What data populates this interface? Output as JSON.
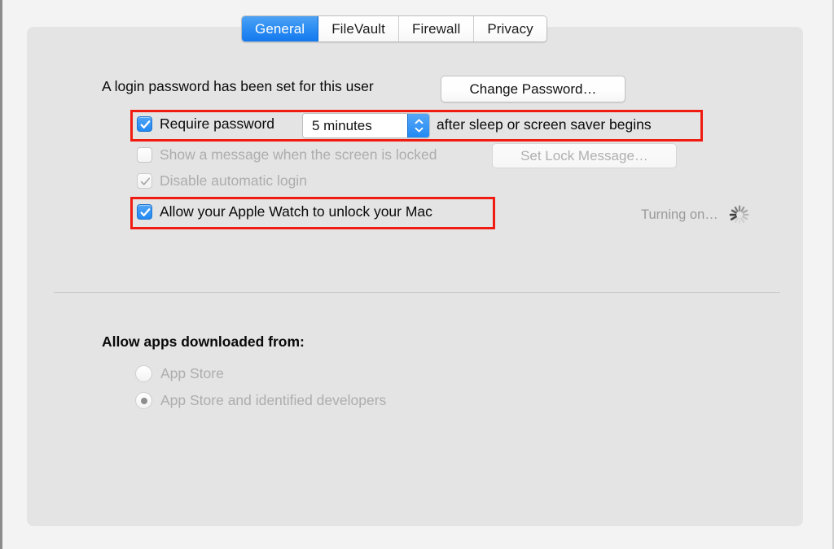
{
  "window": {
    "panel_name": "security-privacy-preference-panel"
  },
  "tabs": [
    {
      "label": "General",
      "selected": true
    },
    {
      "label": "FileVault",
      "selected": false
    },
    {
      "label": "Firewall",
      "selected": false
    },
    {
      "label": "Privacy",
      "selected": false
    }
  ],
  "general": {
    "password_status": "A login password has been set for this user",
    "change_password_label": "Change Password…",
    "require_password": {
      "label": "Require password",
      "checked": true,
      "delay_value": "5 minutes",
      "trailing_text": "after sleep or screen saver begins",
      "stepper_up_icon": "chevron-up-icon",
      "stepper_down_icon": "chevron-down-icon"
    },
    "show_lock_message": {
      "label": "Show a message when the screen is locked",
      "checked": false,
      "button_label": "Set Lock Message…",
      "disabled": true
    },
    "disable_automatic_login": {
      "label": "Disable automatic login",
      "checked": true,
      "disabled": true
    },
    "apple_watch_unlock": {
      "label": "Allow your Apple Watch to unlock your Mac",
      "checked": true,
      "status_label": "Turning on…",
      "status_icon": "spinner-icon"
    }
  },
  "gatekeeper": {
    "heading": "Allow apps downloaded from:",
    "options": [
      {
        "label": "App Store",
        "selected": false,
        "disabled": true
      },
      {
        "label": "App Store and identified developers",
        "selected": true,
        "disabled": true
      }
    ]
  },
  "annotations": {
    "highlight_color": "#f01c12",
    "boxes": [
      {
        "target": "require-password-row"
      },
      {
        "target": "apple-watch-row"
      }
    ]
  }
}
